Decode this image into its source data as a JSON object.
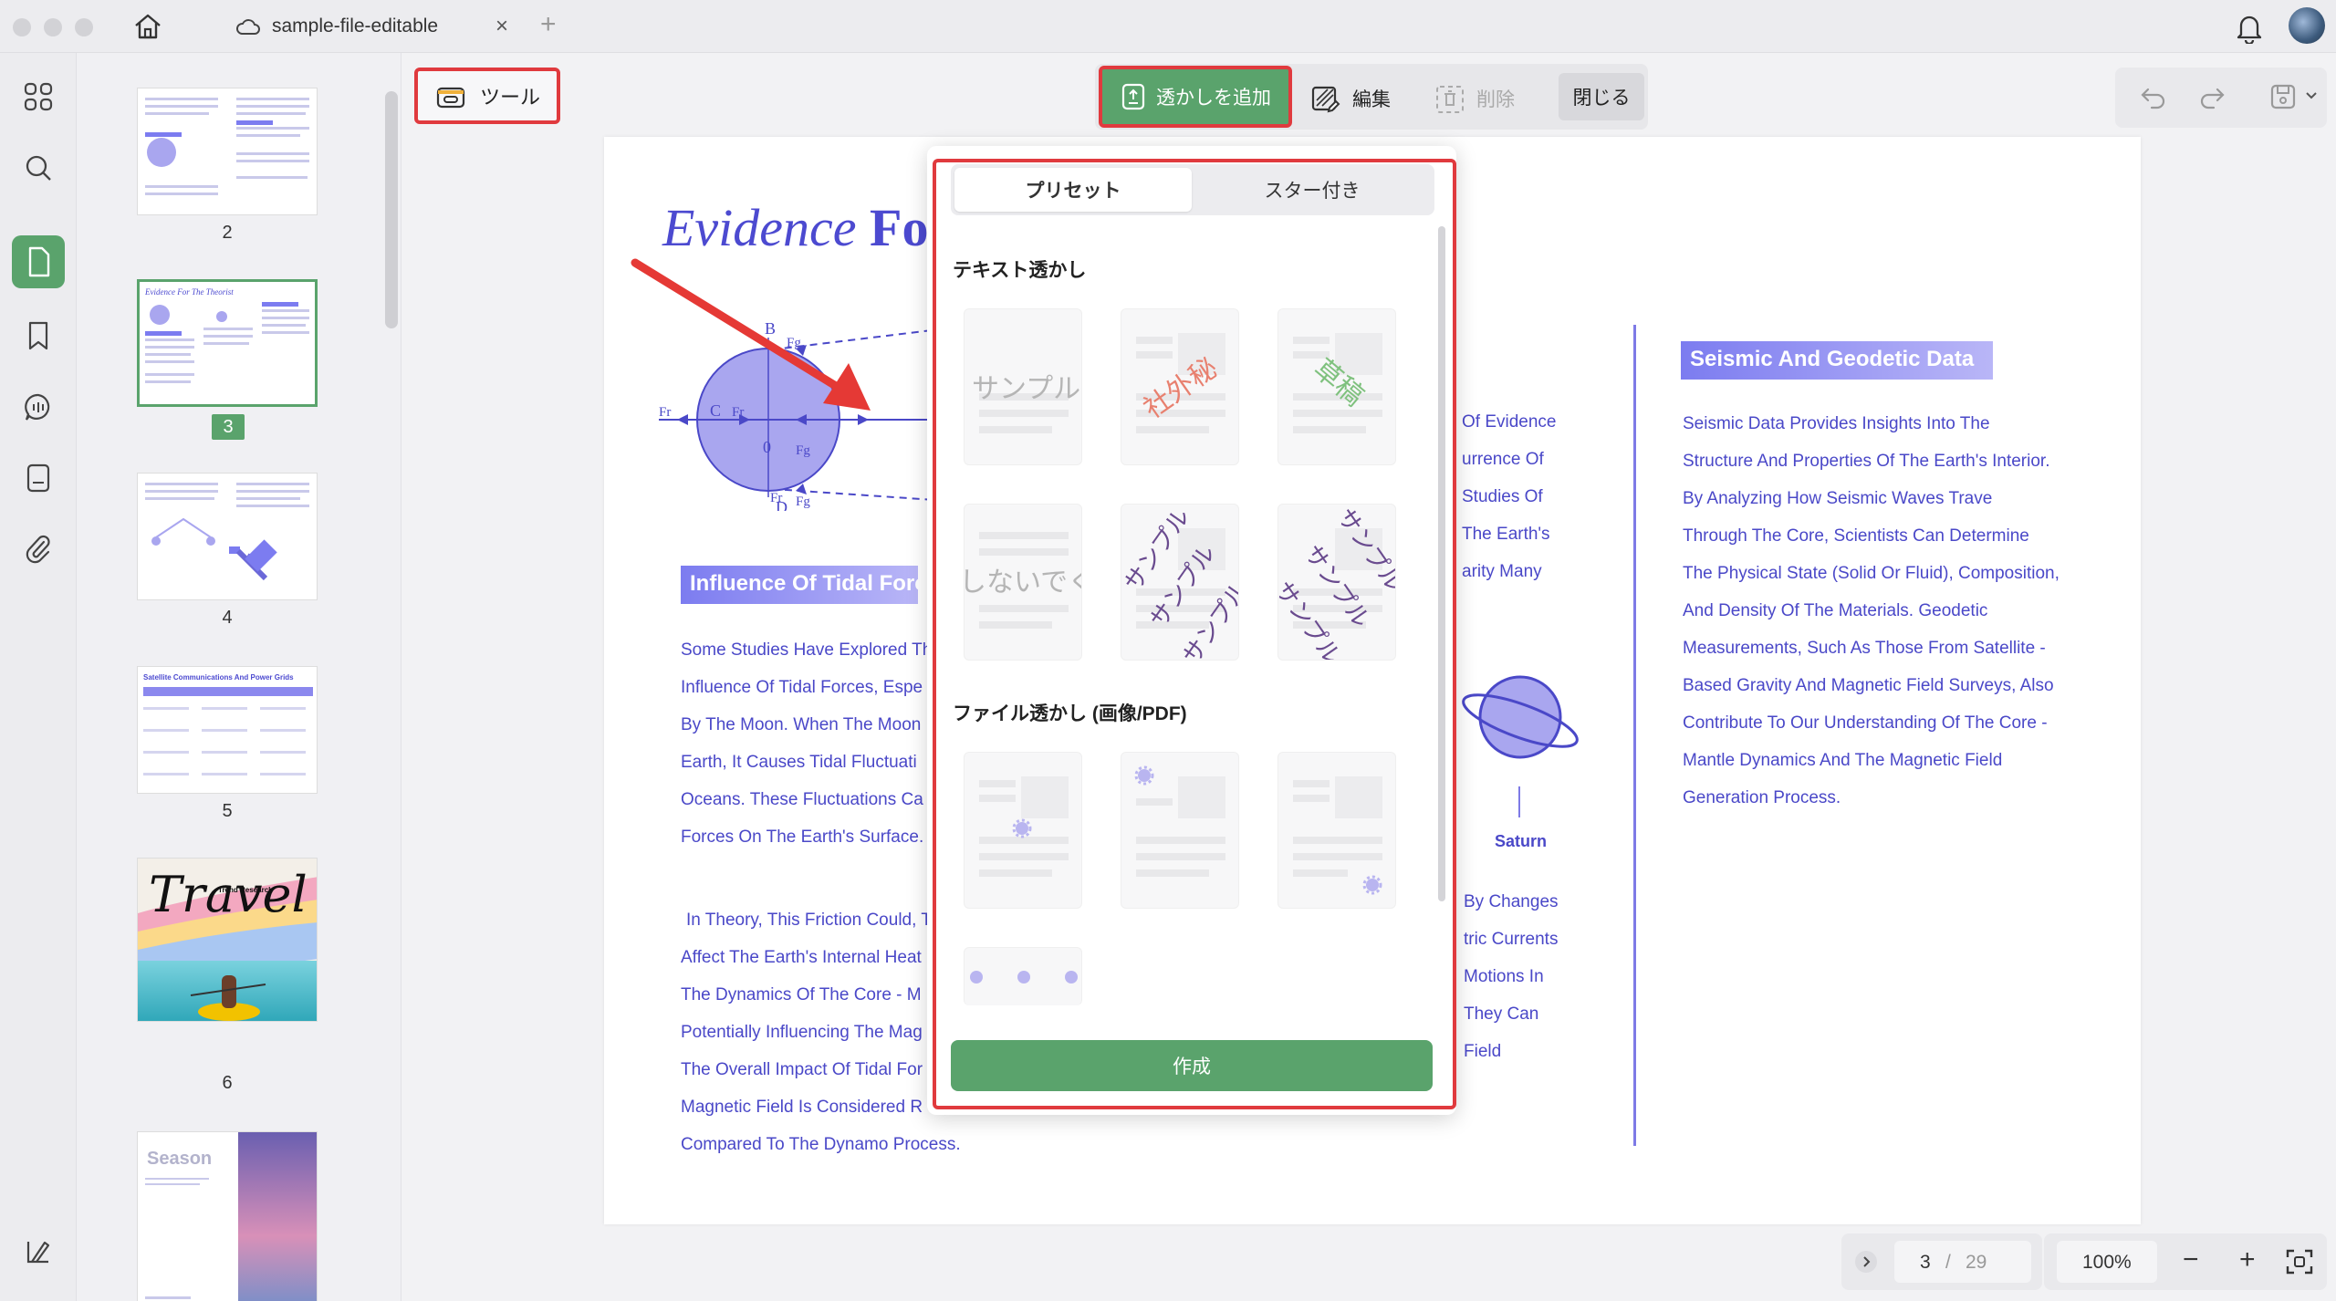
{
  "tab": {
    "title": "sample-file-editable"
  },
  "toolbar": {
    "tools_label": "ツール",
    "add_watermark_label": "透かしを追加",
    "edit_label": "編集",
    "delete_label": "削除",
    "close_label": "閉じる"
  },
  "thumbnails": {
    "pages": [
      "2",
      "3",
      "4",
      "5",
      "6"
    ],
    "selected": "3",
    "thumb_travel_title": "Travel",
    "thumb_travel_sub": "Trend Research",
    "thumb_season": "Season"
  },
  "document": {
    "title_italic": "Evidence",
    "title_bold": "Fo",
    "diagram_labels": {
      "B": "B",
      "D": "D",
      "C": "C",
      "zero": "0",
      "Fr": "Fr",
      "Fg": "Fg"
    },
    "left_section_title": "Influence Of Tidal Forc",
    "left_para1": [
      "Some Studies Have Explored Th",
      "Influence Of Tidal Forces, Espe",
      "By The Moon. When The Moon",
      "Earth, It Causes Tidal Fluctuati",
      "Oceans. These Fluctuations Ca",
      "Forces On The Earth's Surface."
    ],
    "left_para2": [
      "In Theory, This Friction Could, T",
      "Affect The Earth's Internal Heat",
      "The Dynamics Of The Core - M",
      "Potentially Influencing The Mag",
      "The Overall Impact Of Tidal For",
      "Magnetic Field Is Considered R",
      "Compared To The Dynamo Process."
    ],
    "mid_para1": [
      "Of Evidence",
      "urrence Of",
      "Studies Of",
      "The Earth's",
      "arity Many"
    ],
    "mid_para2": [
      "By Changes",
      "tric Currents",
      "Motions In",
      "They Can",
      "Field"
    ],
    "saturn_label": "Saturn",
    "right_section_title": "Seismic And Geodetic Data",
    "right_para": [
      "Seismic Data Provides Insights Into The",
      "Structure And Properties Of The Earth's Interior.",
      "By Analyzing How Seismic Waves Trave",
      "Through The Core, Scientists Can Determine",
      "The Physical State (Solid Or Fluid), Composition,",
      "And Density Of The Materials. Geodetic",
      "Measurements, Such As Those From Satellite -",
      "Based Gravity And Magnetic Field Surveys, Also",
      "Contribute To Our Understanding Of The Core -",
      "Mantle Dynamics And The Magnetic Field",
      "Generation Process."
    ]
  },
  "watermark_panel": {
    "tabs": [
      "プリセット",
      "スター付き"
    ],
    "active_tab": "プリセット",
    "text_section": "テキスト透かし",
    "file_section": "ファイル透かし (画像/PDF)",
    "samples": {
      "sample": "サンプル",
      "confidential": "社外秘",
      "draft": "草稿",
      "donot": "しないでく"
    },
    "create_label": "作成"
  },
  "pager": {
    "current": "3",
    "separator": "/",
    "total": "29"
  },
  "zoom": {
    "level": "100%"
  },
  "colors": {
    "accent": "#5aa36c",
    "highlight": "#e03a3e",
    "doc_text": "#4a48c8"
  }
}
